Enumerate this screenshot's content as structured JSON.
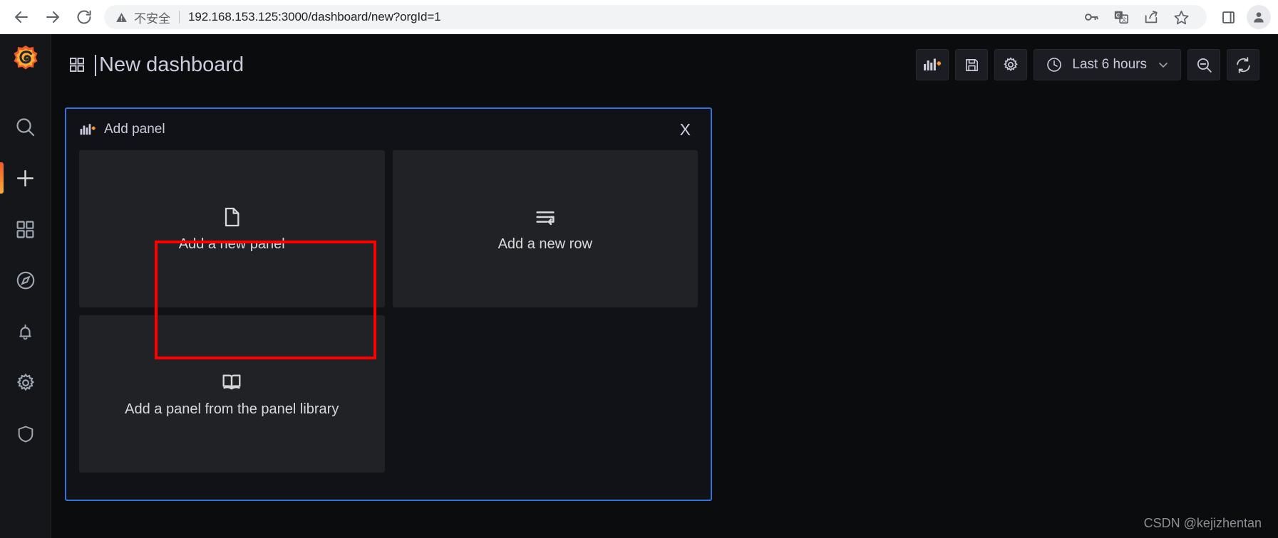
{
  "browser": {
    "back_label": "Back",
    "forward_label": "Forward",
    "reload_label": "Reload",
    "security_label": "不安全",
    "url": "192.168.153.125:3000/dashboard/new?orgId=1",
    "icons": {
      "back": "back-arrow-icon",
      "forward": "forward-arrow-icon",
      "reload": "reload-icon",
      "warning": "warning-triangle-icon",
      "password": "key-icon",
      "translate": "translate-icon",
      "share": "share-icon",
      "bookmark": "star-icon",
      "side_panel": "side-panel-icon",
      "profile": "profile-avatar-icon"
    }
  },
  "sidebar": {
    "logo_label": "Grafana",
    "items": [
      {
        "name": "search",
        "label": "Search"
      },
      {
        "name": "create",
        "label": "Create",
        "active": true
      },
      {
        "name": "dashboards",
        "label": "Dashboards"
      },
      {
        "name": "explore",
        "label": "Explore"
      },
      {
        "name": "alerting",
        "label": "Alerting"
      },
      {
        "name": "configuration",
        "label": "Configuration"
      },
      {
        "name": "server-admin",
        "label": "Server Admin"
      }
    ]
  },
  "header": {
    "title": "New dashboard",
    "tools": {
      "add_panel_label": "Add panel",
      "save_label": "Save dashboard",
      "settings_label": "Dashboard settings",
      "time_range": "Last 6 hours",
      "zoom_out_label": "Zoom out time range",
      "refresh_label": "Refresh dashboard"
    }
  },
  "add_panel_widget": {
    "title": "Add panel",
    "close_label": "X",
    "tiles": [
      {
        "label": "Add a new panel",
        "icon": "file-document-icon",
        "highlighted": true
      },
      {
        "label": "Add a new row",
        "icon": "wrap-text-row-icon",
        "highlighted": false
      },
      {
        "label": "Add a panel from the panel library",
        "icon": "open-book-icon",
        "highlighted": false
      }
    ]
  },
  "watermark": "CSDN @kejizhentan",
  "colors": {
    "accent_blue": "#3871dc",
    "highlight_red": "#ff0000",
    "grafana_orange": "#f05a28",
    "panel_bg": "#111217",
    "tile_bg": "#202226",
    "app_bg": "#0b0c0e"
  }
}
